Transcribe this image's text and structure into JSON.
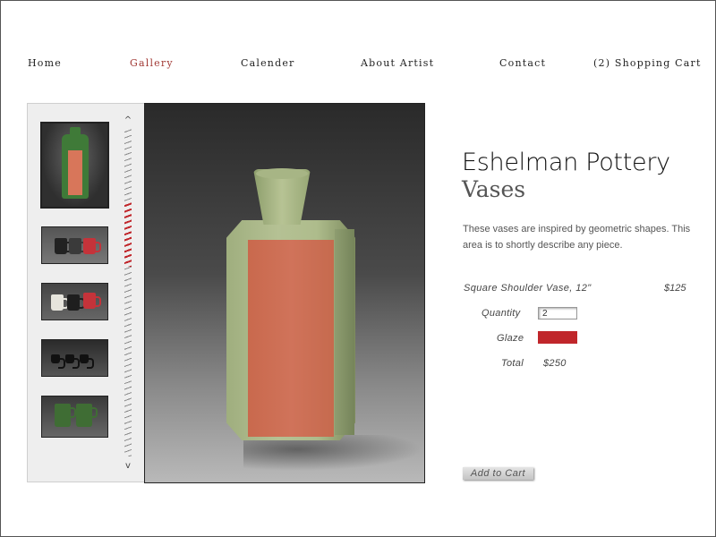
{
  "nav": {
    "home": "Home",
    "gallery": "Gallery",
    "calender": "Calender",
    "about": "About Artist",
    "contact": "Contact",
    "cart": "(2)  Shopping Cart"
  },
  "slider": {
    "up": "^",
    "down": "v"
  },
  "product": {
    "brand": "Eshelman Pottery",
    "category": "Vases",
    "description": "These vases are inspired by geometric shapes. This area is to shortly describe any piece.",
    "name": "Square Shoulder Vase, 12\"",
    "price": "$125",
    "quantity_label": "Quantity",
    "quantity_value": "2",
    "glaze_label": "Glaze",
    "glaze_color": "#c0262b",
    "total_label": "Total",
    "total_value": "$250",
    "add_to_cart": "Add to Cart"
  },
  "colors": {
    "active_nav": "#a23a36",
    "accent_red": "#c0262b"
  }
}
